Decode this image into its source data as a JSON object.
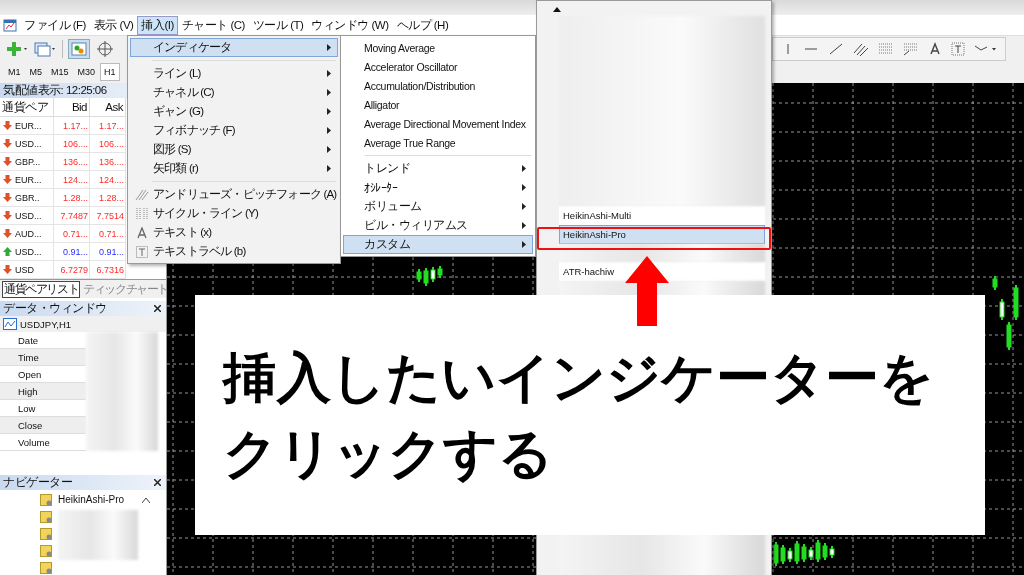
{
  "menu_bar": [
    {
      "label": "ファイル (F)",
      "selected": false
    },
    {
      "label": "表示 (V)",
      "selected": false
    },
    {
      "label": "挿入(I)",
      "selected": true
    },
    {
      "label": "チャート (C)",
      "selected": false
    },
    {
      "label": "ツール (T)",
      "selected": false
    },
    {
      "label": "ウィンドウ (W)",
      "selected": false
    },
    {
      "label": "ヘルプ (H)",
      "selected": false
    }
  ],
  "timeframes": [
    {
      "label": "M1",
      "selected": false
    },
    {
      "label": "M5",
      "selected": false
    },
    {
      "label": "M15",
      "selected": false
    },
    {
      "label": "M30",
      "selected": false
    },
    {
      "label": "H1",
      "selected": true
    }
  ],
  "market_watch": {
    "title": "気配値表示: 12:25:06",
    "columns": [
      "通貨ペア",
      "Bid",
      "Ask"
    ],
    "rows": [
      {
        "symbol": "EUR...",
        "bid": "1.17...",
        "ask": "1.17...",
        "rising": false
      },
      {
        "symbol": "USD...",
        "bid": "106....",
        "ask": "106....",
        "rising": false
      },
      {
        "symbol": "GBP...",
        "bid": "136....",
        "ask": "136....",
        "rising": false
      },
      {
        "symbol": "EUR...",
        "bid": "124....",
        "ask": "124....",
        "rising": false
      },
      {
        "symbol": "GBR..",
        "bid": "1.28...",
        "ask": "1.28...",
        "rising": false
      },
      {
        "symbol": "USD...",
        "bid": "7.7487",
        "ask": "7.7514",
        "rising": false
      },
      {
        "symbol": "AUD...",
        "bid": "0.71...",
        "ask": "0.71...",
        "rising": false
      },
      {
        "symbol": "USD...",
        "bid": "0.91...",
        "ask": "0.91...",
        "rising": true
      },
      {
        "symbol": "USD",
        "bid": "6.7279",
        "ask": "6.7316",
        "rising": false
      }
    ],
    "tabs": [
      {
        "label": "通貨ペアリスト",
        "selected": true
      },
      {
        "label": "ティックチャート",
        "selected": false
      }
    ]
  },
  "data_window": {
    "title": "データ・ウィンドウ",
    "symbol": "USDJPY,H1",
    "rows": [
      "Date",
      "Time",
      "Open",
      "High",
      "Low",
      "Close",
      "Volume"
    ]
  },
  "navigator": {
    "title": "ナビゲーター",
    "items": [
      "HeikinAshi-Pro"
    ]
  },
  "insert_menu": [
    [
      {
        "label": "インディケータ",
        "kind": "submenu",
        "highlighted": true
      }
    ],
    [
      {
        "label": "ライン (L)",
        "kind": "submenu",
        "highlighted": false
      },
      {
        "label": "チャネル (C)",
        "kind": "submenu",
        "highlighted": false
      },
      {
        "label": "ギャン (G)",
        "kind": "submenu",
        "highlighted": false
      },
      {
        "label": "フィボナッチ (F)",
        "kind": "submenu",
        "highlighted": false
      },
      {
        "label": "図形 (S)",
        "kind": "submenu",
        "highlighted": false
      },
      {
        "label": "矢印類 (r)",
        "kind": "submenu",
        "highlighted": false
      }
    ],
    [
      {
        "label": "アンドリューズ・ピッチフォーク (A)",
        "kind": "pitchfork",
        "highlighted": false
      },
      {
        "label": "サイクル・ライン (Y)",
        "kind": "cycle",
        "highlighted": false
      },
      {
        "label": "テキスト (x)",
        "kind": "text",
        "highlighted": false
      },
      {
        "label": "テキストラベル (b)",
        "kind": "label",
        "highlighted": false
      }
    ]
  ],
  "indicator_menu": [
    [
      {
        "label": "Moving Average",
        "kind": "action",
        "highlighted": false
      },
      {
        "label": "Accelerator Oscillator",
        "kind": "action",
        "highlighted": false
      },
      {
        "label": "Accumulation/Distribution",
        "kind": "action",
        "highlighted": false
      },
      {
        "label": "Alligator",
        "kind": "action",
        "highlighted": false
      },
      {
        "label": "Average Directional Movement Index",
        "kind": "action",
        "highlighted": false
      },
      {
        "label": "Average True Range",
        "kind": "action",
        "highlighted": false
      }
    ],
    [
      {
        "label": "トレンド",
        "kind": "submenu",
        "highlighted": false
      },
      {
        "label": "ｵｼﾚｰﾀｰ",
        "kind": "submenu",
        "highlighted": false
      },
      {
        "label": "ボリューム",
        "kind": "submenu",
        "highlighted": false
      },
      {
        "label": "ビル・ウィリアムス",
        "kind": "submenu",
        "highlighted": false
      },
      {
        "label": "カスタム",
        "kind": "submenu",
        "highlighted": true
      }
    ]
  ],
  "custom_menu": [
    {
      "label": "HeikinAshi-Multi",
      "highlighted": false
    },
    {
      "label": "HeikinAshi-Pro",
      "highlighted": true
    },
    {
      "label": "ATR-hachiw",
      "highlighted": false
    }
  ],
  "annotation": {
    "lines": [
      "挿入したいインジケーターを",
      "クリックする"
    ]
  }
}
